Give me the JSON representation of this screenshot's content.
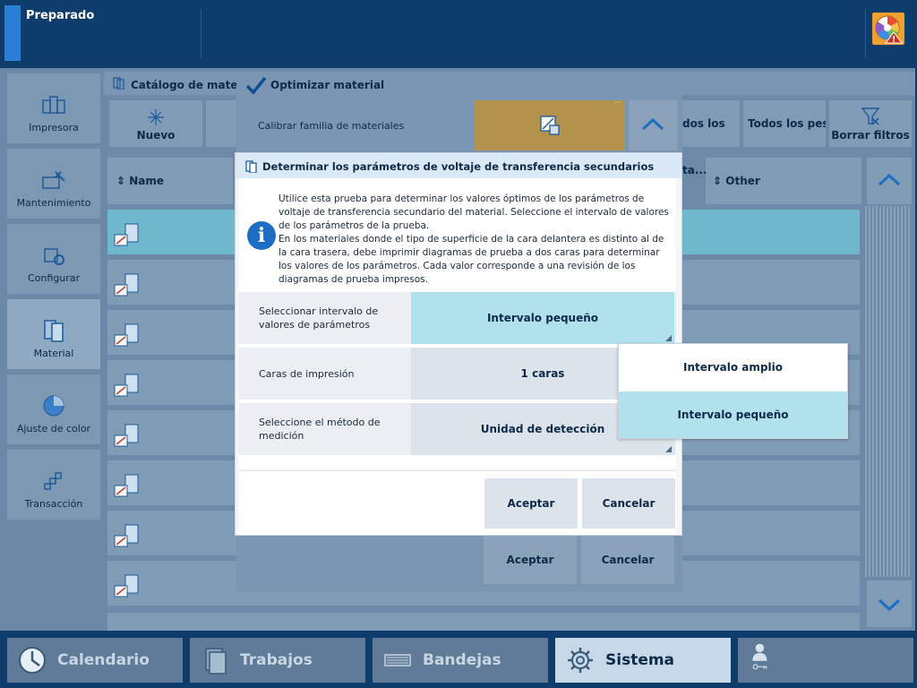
{
  "status": {
    "text": "Preparado"
  },
  "colors": {
    "top_bar": "#0e3d6c",
    "accent_blue": "#2b7fd6",
    "selected_cyan": "#b2e1ee",
    "alert_orange": "#f0a030",
    "warning_red": "#d03020"
  },
  "left_nav": {
    "items": [
      {
        "label": "Impresora",
        "icon": "printer-icon"
      },
      {
        "label": "Mantenimiento",
        "icon": "maintenance-icon"
      },
      {
        "label": "Configurar",
        "icon": "configure-icon"
      },
      {
        "label": "Material",
        "icon": "material-icon",
        "active": true
      },
      {
        "label": "Ajuste de color",
        "icon": "color-adjust-icon"
      },
      {
        "label": "Transacción",
        "icon": "transaction-icon"
      }
    ]
  },
  "catalog": {
    "title": "Catálogo de material",
    "toolbar": {
      "new_label": "Nuevo",
      "filter_all_ta": "dos los ta...",
      "filter_all_pes": "Todos los pes...",
      "clear_filters": "Borrar filtros"
    },
    "columns": {
      "name": "Name",
      "other": "Other"
    }
  },
  "optimize_panel": {
    "title": "Optimizar material",
    "calibrate_label": "Calibrar familia de materiales",
    "accept_label": "Aceptar",
    "cancel_label": "Cancelar"
  },
  "dialog": {
    "title": "Determinar los parámetros de voltaje de transferencia secundarios",
    "info_icon_glyph": "i",
    "info_paragraph_1": "Utilice esta prueba para determinar los valores óptimos de los parámetros de voltaje de transferencia secundario del material. Seleccione el intervalo de valores de los parámetros de la prueba.",
    "info_paragraph_2": "En los materiales donde el tipo de superficie de la cara delantera es distinto al de la cara trasera, debe imprimir diagramas de prueba a dos caras para determinar los valores de los parámetros. Cada valor corresponde a una revisión de los diagramas de prueba impresos.",
    "fields": {
      "range": {
        "label": "Seleccionar intervalo de valores de parámetros",
        "value": "Intervalo pequeño"
      },
      "sides": {
        "label": "Caras de impresión",
        "value": "1 caras"
      },
      "method": {
        "label": "Seleccione el método de medición",
        "value": "Unidad de detección"
      }
    },
    "accept_label": "Aceptar",
    "cancel_label": "Cancelar"
  },
  "dropdown": {
    "options": [
      {
        "label": "Intervalo amplio",
        "selected": false
      },
      {
        "label": "Intervalo pequeño",
        "selected": true
      }
    ]
  },
  "bottom_tabs": [
    {
      "label": "Calendario",
      "icon": "clock-icon"
    },
    {
      "label": "Trabajos",
      "icon": "jobs-icon"
    },
    {
      "label": "Bandejas",
      "icon": "trays-icon"
    },
    {
      "label": "Sistema",
      "icon": "gear-icon",
      "active": true
    },
    {
      "label": "",
      "icon": "user-key-icon"
    }
  ]
}
